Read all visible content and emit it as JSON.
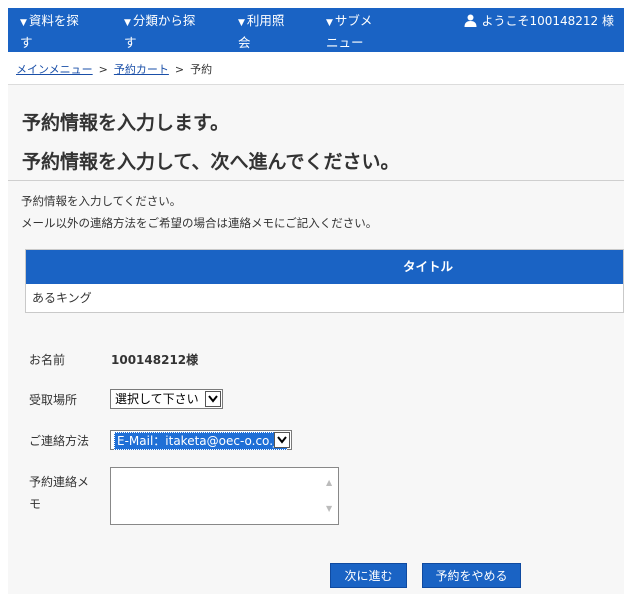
{
  "nav": {
    "items": [
      {
        "label_line1": "資料を探",
        "label_line2": "す"
      },
      {
        "label_line1": "分類から探",
        "label_line2": "す"
      },
      {
        "label_line1": "利用照",
        "label_line2": "会"
      },
      {
        "label_line1": "サブメ",
        "label_line2": "ニュー"
      }
    ],
    "welcome": "ようこそ100148212 様"
  },
  "breadcrumb": {
    "items": [
      "メインメニュー",
      "予約カート",
      "予約"
    ],
    "separator": ">"
  },
  "page": {
    "title": "予約情報を入力します。",
    "subtitle": "予約情報を入力して、次へ進んでください。",
    "desc1": "予約情報を入力してください。",
    "desc2": "メール以外の連絡方法をご希望の場合は連絡メモにご記入ください。"
  },
  "table": {
    "header": "タイトル",
    "rows": [
      "あるキング"
    ]
  },
  "form": {
    "name_label": "お名前",
    "name_value": "100148212様",
    "pickup_label": "受取場所",
    "pickup_value": "選択して下さい",
    "contact_label": "ご連絡方法",
    "contact_value": "E-Mail：itaketa@oec-o.co.jp",
    "memo_label_line1": "予約連絡メ",
    "memo_label_line2": "モ",
    "memo_value": ""
  },
  "buttons": {
    "next": "次に進む",
    "cancel": "予約をやめる"
  },
  "colors": {
    "brand": "#1a63c4",
    "link": "#1a4fa8"
  }
}
